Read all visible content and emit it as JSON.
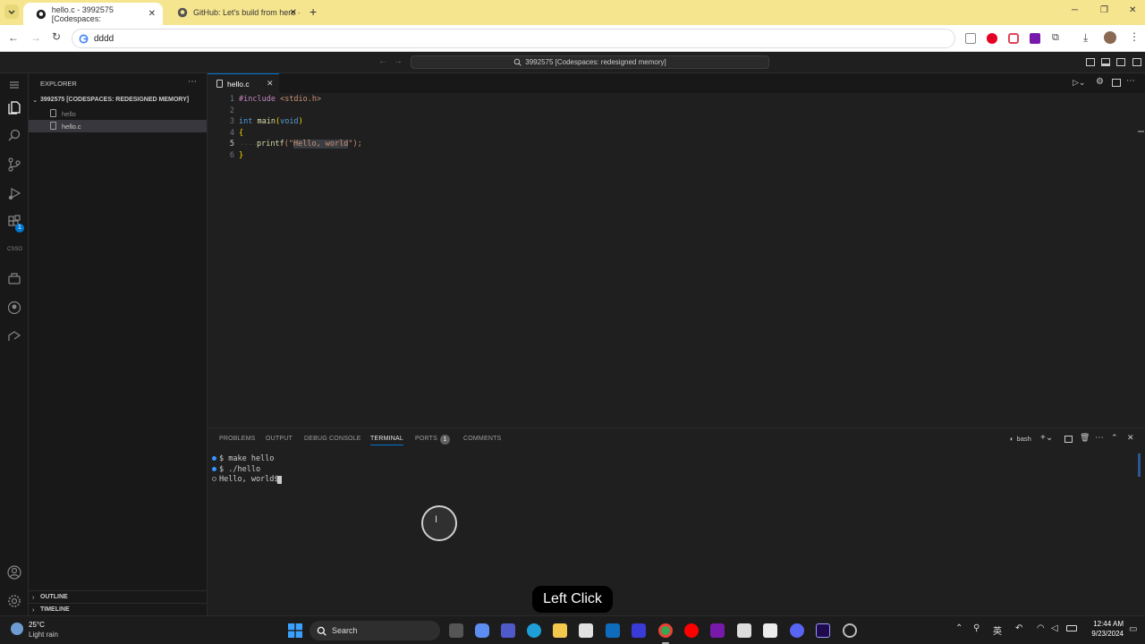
{
  "browser": {
    "tabs": [
      {
        "title": "hello.c - 3992575 [Codespaces:"
      },
      {
        "title": "GitHub: Let's build from here ·"
      }
    ],
    "address": "dddd"
  },
  "vscode": {
    "command_center": "3992575 [Codespaces: redesigned memory]",
    "activity_badge": "1",
    "activity_label": "CSSO",
    "explorer": {
      "title": "EXPLORER",
      "root": "3992575 [CODESPACES: REDESIGNED MEMORY]",
      "files": [
        {
          "name": "hello"
        },
        {
          "name": "hello.c"
        }
      ],
      "outline": "OUTLINE",
      "timeline": "TIMELINE"
    },
    "editor_tab": "hello.c",
    "code": {
      "line_numbers": [
        "1",
        "2",
        "3",
        "4",
        "5",
        "6"
      ],
      "include_kw": "#include",
      "include_file": " <stdio.h>",
      "int_kw": "int",
      "main_fn": " main",
      "main_open": "(",
      "void_kw": "void",
      "main_close": ")",
      "brace_open": "{",
      "printf_fn": "printf",
      "printf_open": "(\"",
      "string": "Hello, world",
      "printf_close": "\");",
      "brace_close": "}"
    },
    "panel": {
      "tabs": [
        "PROBLEMS",
        "OUTPUT",
        "DEBUG CONSOLE",
        "TERMINAL",
        "PORTS",
        "COMMENTS"
      ],
      "ports_badge": "1",
      "shell": "bash",
      "terminal_lines": [
        "$ make hello",
        "$ ./hello",
        "Hello, world$ "
      ]
    }
  },
  "overlay": {
    "label": "Left Click"
  },
  "taskbar": {
    "weather_temp": "25°C",
    "weather_desc": "Light rain",
    "search": "Search",
    "ime": "英",
    "time": "12:44 AM",
    "date": "9/23/2024"
  }
}
